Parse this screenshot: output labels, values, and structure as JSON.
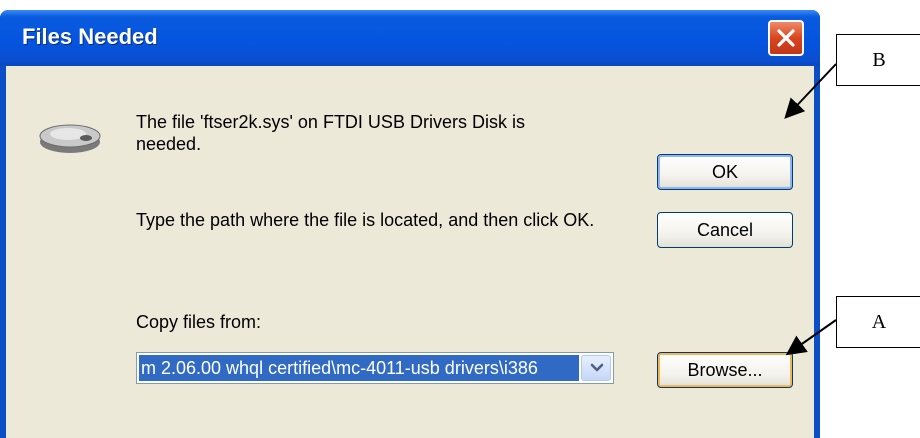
{
  "window": {
    "title": "Files Needed",
    "close_icon": "close-x-icon"
  },
  "message": {
    "icon": "disk-drive-icon",
    "needed_text": "The file 'ftser2k.sys' on FTDI USB Drivers Disk is needed.",
    "instruction_text": "Type the path where the file is located, and then click OK."
  },
  "copy_from": {
    "label": "Copy files from:",
    "value": "m 2.06.00 whql certified\\mc-4011-usb drivers\\i386"
  },
  "buttons": {
    "ok": "OK",
    "cancel": "Cancel",
    "browse": "Browse..."
  },
  "callouts": {
    "b": "B",
    "a": "A"
  },
  "colors": {
    "titlebar": "#0554e0",
    "client_bg": "#ece9d8",
    "selection": "#316ac5",
    "close_red": "#d8461f"
  }
}
